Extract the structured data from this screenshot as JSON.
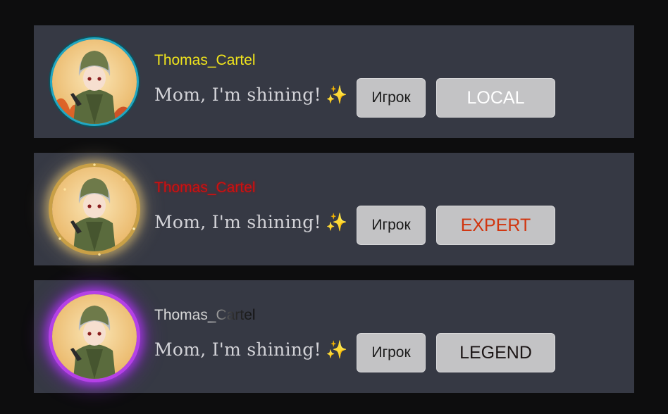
{
  "cards": [
    {
      "username": "Thomas_Cartel",
      "username_color": "#f1e51c",
      "status": "Mom, I'm shining!",
      "status_emoji": "✨",
      "role_button": "Игрок",
      "rank_button": "LOCAL",
      "rank_color": "#ffffff",
      "avatar_frame": "cyan-ring",
      "frame_color": "#21a7c2"
    },
    {
      "username": "Thomas_Cartel",
      "username_color": "#cf1010",
      "status": "Mom, I'm shining!",
      "status_emoji": "✨",
      "role_button": "Игрок",
      "rank_button": "EXPERT",
      "rank_color": "#d1350f",
      "avatar_frame": "gold-sparkle-ring",
      "frame_color": "#c9a046"
    },
    {
      "username": "Thomas_Cartel",
      "username_color": "#e4e4e4",
      "status": "Mom, I'm shining!",
      "status_emoji": "✨",
      "role_button": "Игрок",
      "rank_button": "LEGEND",
      "rank_color": "#1c1616",
      "avatar_frame": "purple-glow-ring",
      "frame_color": "#b541e6"
    }
  ]
}
